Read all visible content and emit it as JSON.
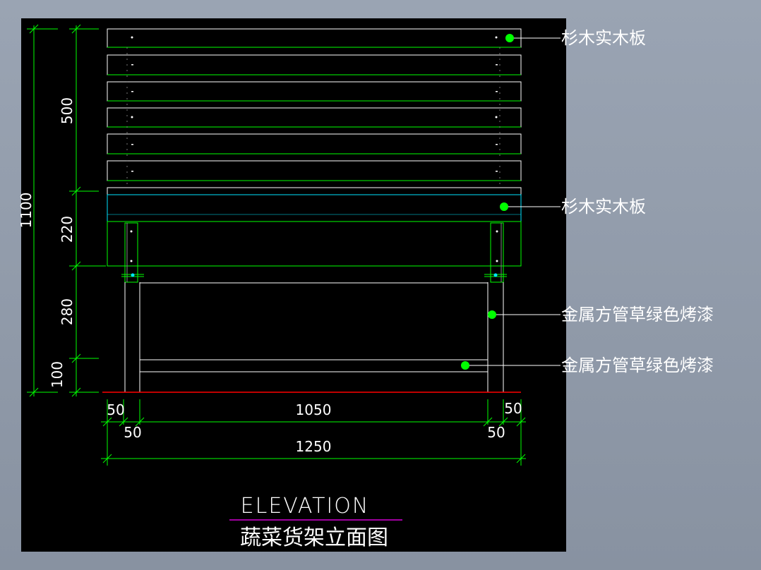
{
  "drawing": {
    "title_en": "ELEVATION",
    "title_cn": "蔬菜货架立面图"
  },
  "callouts": [
    {
      "label": "杉木实木板"
    },
    {
      "label": "杉木实木板"
    },
    {
      "label": "金属方管草绿色烤漆"
    },
    {
      "label": "金属方管草绿色烤漆"
    }
  ],
  "dimensions": {
    "vertical": {
      "overall": "1100",
      "segments": [
        "500",
        "220",
        "280",
        "100"
      ]
    },
    "horizontal": {
      "top_left_outer": "50",
      "top_left_inner": "50",
      "middle": "1050",
      "top_right_inner": "50",
      "top_right_outer": "50",
      "overall": "1250"
    }
  },
  "colors": {
    "background": "#000000",
    "dimension": "#00ff00",
    "wood": "#ffffff",
    "wood_trim": "#00ff00",
    "apron": "#00e5ff",
    "ground": "#ff0000",
    "title_underline": "#ff00ff",
    "callout_dot": "#00ff00"
  }
}
